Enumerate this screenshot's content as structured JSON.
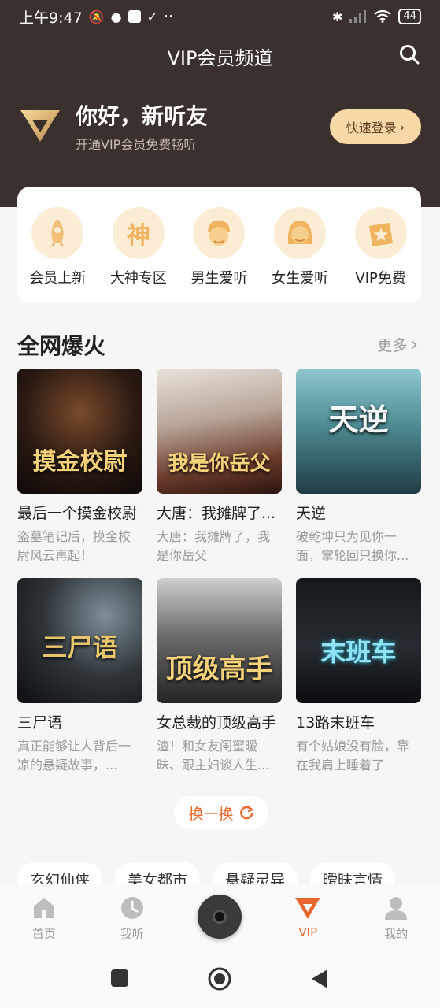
{
  "status_bar": {
    "time": "上午9:47",
    "extra": "··",
    "battery": "44"
  },
  "header": {
    "title": "VIP会员频道",
    "greeting": "你好，新听友",
    "subtitle": "开通VIP会员免费畅听",
    "login_label": "快速登录",
    "accent": "#f7d8a6",
    "background": "#3a302d"
  },
  "quick_links": [
    {
      "label": "会员上新",
      "icon": "rocket-icon"
    },
    {
      "label": "大神专区",
      "icon": "god-icon",
      "glyph": "神"
    },
    {
      "label": "男生爱听",
      "icon": "boy-icon"
    },
    {
      "label": "女生爱听",
      "icon": "girl-icon"
    },
    {
      "label": "VIP免费",
      "icon": "star-badge-icon"
    }
  ],
  "section": {
    "title": "全网爆火",
    "more_label": "更多"
  },
  "books": [
    {
      "title": "最后一个摸金校尉",
      "desc": "盗墓笔记后，摸金校尉风云再起！",
      "cover_text": "摸金校尉"
    },
    {
      "title": "大唐：我摊牌了...",
      "desc": "大唐：我摊牌了，我是你岳父",
      "cover_text": "我是你岳父"
    },
    {
      "title": "天逆",
      "desc": "破乾坤只为见你一面，掌轮回只换你...",
      "cover_text": "天逆"
    },
    {
      "title": "三尸语",
      "desc": "真正能够让人背后一凉的悬疑故事，...",
      "cover_text": "三尸语"
    },
    {
      "title": "女总裁的顶级高手",
      "desc": "渣！和女友闺蜜暧昧、跟主妇谈人生...",
      "cover_text": "顶级高手"
    },
    {
      "title": "13路末班车",
      "desc": "有个姑娘没有脸，靠在我肩上睡着了",
      "cover_text": "末班车"
    }
  ],
  "refresh_label": "换一换",
  "genre_chips": [
    "玄幻仙侠",
    "美女都市",
    "悬疑灵异",
    "暧昧言情"
  ],
  "tabs": [
    {
      "label": "首页",
      "icon": "home-icon"
    },
    {
      "label": "我听",
      "icon": "clock-icon"
    },
    {
      "label": "",
      "icon": "disc-icon"
    },
    {
      "label": "VIP",
      "icon": "vip-icon",
      "active": true
    },
    {
      "label": "我的",
      "icon": "profile-icon"
    }
  ],
  "active_color": "#e8652d"
}
